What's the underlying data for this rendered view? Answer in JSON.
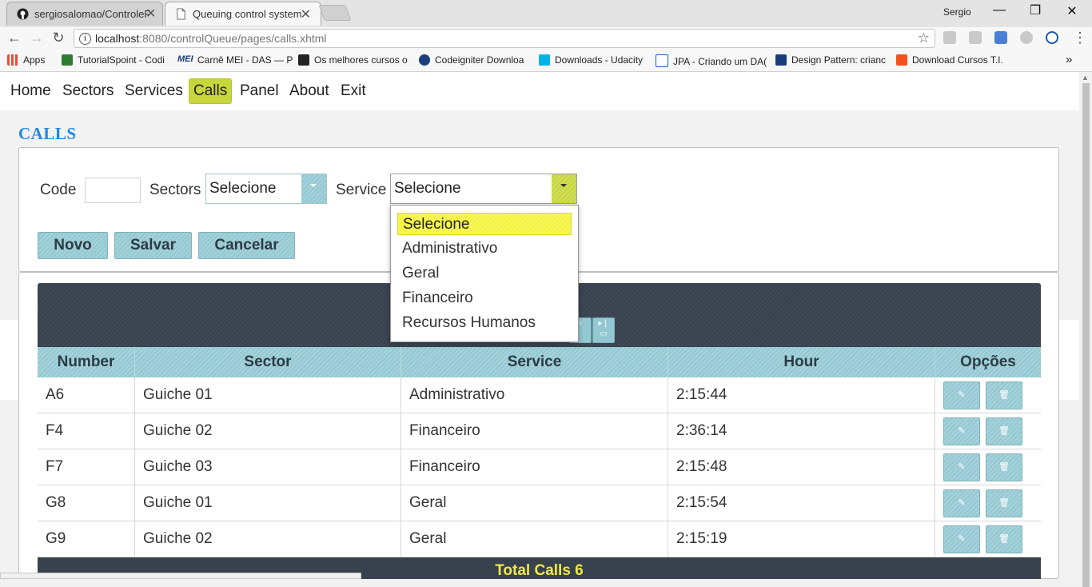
{
  "browser": {
    "tabs": [
      {
        "title": "sergiosalomao/ControleF",
        "icon": "github-icon"
      },
      {
        "title": "Queuing control system",
        "icon": "page-icon"
      }
    ],
    "user": "Sergio",
    "url_host": "localhost",
    "url_rest": ":8080/controlQueue/pages/calls.xhtml",
    "bookmarks": [
      {
        "label": "Apps",
        "color": "#e8493f"
      },
      {
        "label": "TutorialSpoint - Codi",
        "color": "#2e7d32"
      },
      {
        "label": "MEI",
        "color": "#1a3d7c"
      },
      {
        "label": "Carnê MEI - DAS — P",
        "color": "#ffffff"
      },
      {
        "label": "Os melhores cursos o",
        "color": "#f5c400"
      },
      {
        "label": "Codeigniter Downloa",
        "color": "#1a3d7c"
      },
      {
        "label": "Downloads - Udacity",
        "color": "#02b3e4"
      },
      {
        "label": "JPA - Criando um DA(",
        "color": "#1565c0"
      },
      {
        "label": "Design Pattern: crianc",
        "color": "#1a3d7c"
      },
      {
        "label": "Download Cursos T.I.",
        "color": "#f4511e"
      }
    ],
    "bookmarks_more": "»"
  },
  "menu": [
    "Home",
    "Sectors",
    "Services",
    "Calls",
    "Panel",
    "About",
    "Exit"
  ],
  "page_title": "CALLS",
  "form": {
    "code_label": "Code",
    "code_value": "",
    "sectors_label": "Sectors",
    "sectors_value": "Selecione",
    "service_label": "Service",
    "service_value": "Selecione",
    "service_options": [
      "Selecione",
      "Administrativo",
      "Geral",
      "Financeiro",
      "Recursos Humanos"
    ],
    "buttons": {
      "new": "Novo",
      "save": "Salvar",
      "cancel": "Cancelar"
    }
  },
  "table": {
    "columns": [
      "Number",
      "Sector",
      "Service",
      "Hour",
      "Opções"
    ],
    "rows": [
      {
        "number": "A6",
        "sector": "Guiche 01",
        "service": "Administrativo",
        "hour": "2:15:44"
      },
      {
        "number": "F4",
        "sector": "Guiche 02",
        "service": "Financeiro",
        "hour": "2:36:14"
      },
      {
        "number": "F7",
        "sector": "Guiche 03",
        "service": "Financeiro",
        "hour": "2:15:48"
      },
      {
        "number": "G8",
        "sector": "Guiche 01",
        "service": "Geral",
        "hour": "2:15:54"
      },
      {
        "number": "G9",
        "sector": "Guiche 02",
        "service": "Geral",
        "hour": "2:15:19"
      }
    ],
    "footer": "Total Calls 6"
  },
  "colors": {
    "accent": "#93c8d2",
    "selected_menu": "#c7d63a",
    "highlight": "#f4f336",
    "title": "#1e88e5",
    "dark": "#37424e"
  }
}
